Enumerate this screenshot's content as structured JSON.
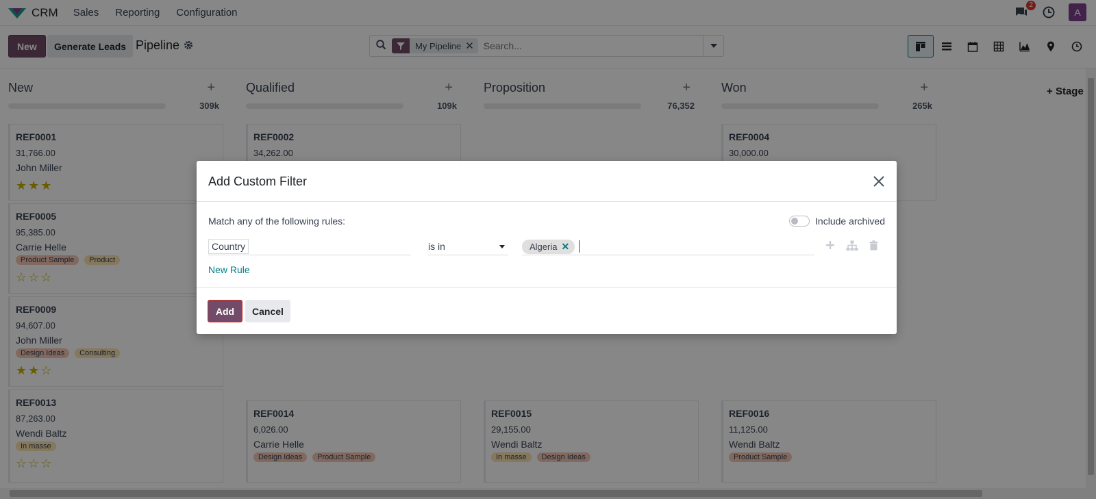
{
  "navbar": {
    "app_name": "CRM",
    "menu": [
      "Sales",
      "Reporting",
      "Configuration"
    ],
    "messages_badge": "2",
    "user_initial": "A"
  },
  "control": {
    "new_label": "New",
    "generate_label": "Generate Leads",
    "title": "Pipeline",
    "facet_label": "My Pipeline",
    "search_placeholder": "Search..."
  },
  "kanban": {
    "columns": [
      {
        "title": "New",
        "total": "309k"
      },
      {
        "title": "Qualified",
        "total": "109k"
      },
      {
        "title": "Proposition",
        "total": "76,352"
      },
      {
        "title": "Won",
        "total": "265k"
      }
    ],
    "cards": {
      "c1": {
        "ref": "REF0001",
        "amount": "31,766.00",
        "name": "John Miller"
      },
      "c5": {
        "ref": "REF0005",
        "amount": "95,385.00",
        "name": "Carrie Helle",
        "tag1": "Product Sample",
        "tag2": "Product"
      },
      "c9": {
        "ref": "REF0009",
        "amount": "94,607.00",
        "name": "John Miller",
        "tag1": "Design Ideas",
        "tag2": "Consulting"
      },
      "c13": {
        "ref": "REF0013",
        "amount": "87,263.00",
        "name": "Wendi Baltz",
        "tag1": "In masse"
      },
      "c2": {
        "ref": "REF0002",
        "amount": "34,262.00"
      },
      "c14": {
        "ref": "REF0014",
        "amount": "6,026.00",
        "name": "Carrie Helle",
        "tag1": "Design Ideas",
        "tag2": "Product Sample"
      },
      "c15": {
        "ref": "REF0015",
        "amount": "29,155.00",
        "name": "Wendi Baltz",
        "tag1": "In masse",
        "tag2": "Design Ideas"
      },
      "c4": {
        "ref": "REF0004",
        "amount": "30,000.00"
      },
      "c16": {
        "ref": "REF0016",
        "amount": "11,125.00",
        "name": "Wendi Baltz",
        "tag1": "Product Sample"
      }
    },
    "add_stage": "Stage"
  },
  "modal": {
    "title": "Add Custom Filter",
    "rules_label": "Match any of the following rules:",
    "include_archived": "Include archived",
    "field": "Country",
    "operator": "is in",
    "value_tag": "Algeria",
    "new_rule": "New Rule",
    "add_label": "Add",
    "cancel_label": "Cancel"
  }
}
